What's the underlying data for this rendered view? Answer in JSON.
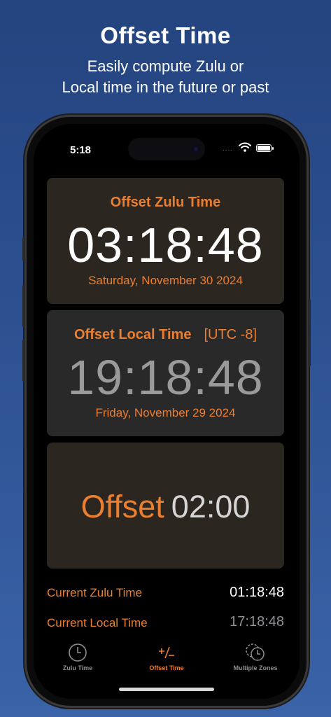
{
  "promo": {
    "title": "Offset Time",
    "subtitle_line1": "Easily compute Zulu or",
    "subtitle_line2": "Local time in the future or past"
  },
  "status_bar": {
    "time": "5:18",
    "signal": "....",
    "battery_level": 1.0
  },
  "offset_zulu": {
    "title": "Offset Zulu Time",
    "time": "03:18:48",
    "date": "Saturday, November 30 2024"
  },
  "offset_local": {
    "title": "Offset Local Time",
    "utc": "[UTC -8]",
    "time": "19:18:48",
    "date": "Friday, November 29 2024"
  },
  "offset": {
    "label": "Offset",
    "value": "02:00"
  },
  "current": {
    "zulu_label": "Current Zulu Time",
    "zulu_value": "01:18:48",
    "local_label": "Current Local Time",
    "local_value": "17:18:48"
  },
  "tabs": [
    {
      "label": "Zulu Time",
      "icon": "clock-icon",
      "active": false
    },
    {
      "label": "Offset Time",
      "icon": "plus-minus-icon",
      "active": true
    },
    {
      "label": "Multiple Zones",
      "icon": "multiple-clocks-icon",
      "active": false
    }
  ],
  "colors": {
    "accent": "#ec7f2f",
    "card_warm": "#2c2621",
    "card_gray": "#292929",
    "background_top": "#24447f",
    "background_bottom": "#3a63a8"
  }
}
